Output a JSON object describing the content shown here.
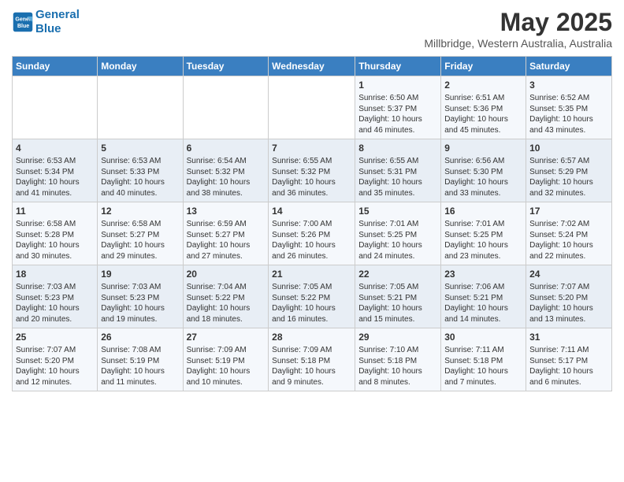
{
  "logo": {
    "line1": "General",
    "line2": "Blue"
  },
  "title": "May 2025",
  "location": "Millbridge, Western Australia, Australia",
  "headers": [
    "Sunday",
    "Monday",
    "Tuesday",
    "Wednesday",
    "Thursday",
    "Friday",
    "Saturday"
  ],
  "weeks": [
    [
      {
        "day": "",
        "info": ""
      },
      {
        "day": "",
        "info": ""
      },
      {
        "day": "",
        "info": ""
      },
      {
        "day": "",
        "info": ""
      },
      {
        "day": "1",
        "info": "Sunrise: 6:50 AM\nSunset: 5:37 PM\nDaylight: 10 hours\nand 46 minutes."
      },
      {
        "day": "2",
        "info": "Sunrise: 6:51 AM\nSunset: 5:36 PM\nDaylight: 10 hours\nand 45 minutes."
      },
      {
        "day": "3",
        "info": "Sunrise: 6:52 AM\nSunset: 5:35 PM\nDaylight: 10 hours\nand 43 minutes."
      }
    ],
    [
      {
        "day": "4",
        "info": "Sunrise: 6:53 AM\nSunset: 5:34 PM\nDaylight: 10 hours\nand 41 minutes."
      },
      {
        "day": "5",
        "info": "Sunrise: 6:53 AM\nSunset: 5:33 PM\nDaylight: 10 hours\nand 40 minutes."
      },
      {
        "day": "6",
        "info": "Sunrise: 6:54 AM\nSunset: 5:32 PM\nDaylight: 10 hours\nand 38 minutes."
      },
      {
        "day": "7",
        "info": "Sunrise: 6:55 AM\nSunset: 5:32 PM\nDaylight: 10 hours\nand 36 minutes."
      },
      {
        "day": "8",
        "info": "Sunrise: 6:55 AM\nSunset: 5:31 PM\nDaylight: 10 hours\nand 35 minutes."
      },
      {
        "day": "9",
        "info": "Sunrise: 6:56 AM\nSunset: 5:30 PM\nDaylight: 10 hours\nand 33 minutes."
      },
      {
        "day": "10",
        "info": "Sunrise: 6:57 AM\nSunset: 5:29 PM\nDaylight: 10 hours\nand 32 minutes."
      }
    ],
    [
      {
        "day": "11",
        "info": "Sunrise: 6:58 AM\nSunset: 5:28 PM\nDaylight: 10 hours\nand 30 minutes."
      },
      {
        "day": "12",
        "info": "Sunrise: 6:58 AM\nSunset: 5:27 PM\nDaylight: 10 hours\nand 29 minutes."
      },
      {
        "day": "13",
        "info": "Sunrise: 6:59 AM\nSunset: 5:27 PM\nDaylight: 10 hours\nand 27 minutes."
      },
      {
        "day": "14",
        "info": "Sunrise: 7:00 AM\nSunset: 5:26 PM\nDaylight: 10 hours\nand 26 minutes."
      },
      {
        "day": "15",
        "info": "Sunrise: 7:01 AM\nSunset: 5:25 PM\nDaylight: 10 hours\nand 24 minutes."
      },
      {
        "day": "16",
        "info": "Sunrise: 7:01 AM\nSunset: 5:25 PM\nDaylight: 10 hours\nand 23 minutes."
      },
      {
        "day": "17",
        "info": "Sunrise: 7:02 AM\nSunset: 5:24 PM\nDaylight: 10 hours\nand 22 minutes."
      }
    ],
    [
      {
        "day": "18",
        "info": "Sunrise: 7:03 AM\nSunset: 5:23 PM\nDaylight: 10 hours\nand 20 minutes."
      },
      {
        "day": "19",
        "info": "Sunrise: 7:03 AM\nSunset: 5:23 PM\nDaylight: 10 hours\nand 19 minutes."
      },
      {
        "day": "20",
        "info": "Sunrise: 7:04 AM\nSunset: 5:22 PM\nDaylight: 10 hours\nand 18 minutes."
      },
      {
        "day": "21",
        "info": "Sunrise: 7:05 AM\nSunset: 5:22 PM\nDaylight: 10 hours\nand 16 minutes."
      },
      {
        "day": "22",
        "info": "Sunrise: 7:05 AM\nSunset: 5:21 PM\nDaylight: 10 hours\nand 15 minutes."
      },
      {
        "day": "23",
        "info": "Sunrise: 7:06 AM\nSunset: 5:21 PM\nDaylight: 10 hours\nand 14 minutes."
      },
      {
        "day": "24",
        "info": "Sunrise: 7:07 AM\nSunset: 5:20 PM\nDaylight: 10 hours\nand 13 minutes."
      }
    ],
    [
      {
        "day": "25",
        "info": "Sunrise: 7:07 AM\nSunset: 5:20 PM\nDaylight: 10 hours\nand 12 minutes."
      },
      {
        "day": "26",
        "info": "Sunrise: 7:08 AM\nSunset: 5:19 PM\nDaylight: 10 hours\nand 11 minutes."
      },
      {
        "day": "27",
        "info": "Sunrise: 7:09 AM\nSunset: 5:19 PM\nDaylight: 10 hours\nand 10 minutes."
      },
      {
        "day": "28",
        "info": "Sunrise: 7:09 AM\nSunset: 5:18 PM\nDaylight: 10 hours\nand 9 minutes."
      },
      {
        "day": "29",
        "info": "Sunrise: 7:10 AM\nSunset: 5:18 PM\nDaylight: 10 hours\nand 8 minutes."
      },
      {
        "day": "30",
        "info": "Sunrise: 7:11 AM\nSunset: 5:18 PM\nDaylight: 10 hours\nand 7 minutes."
      },
      {
        "day": "31",
        "info": "Sunrise: 7:11 AM\nSunset: 5:17 PM\nDaylight: 10 hours\nand 6 minutes."
      }
    ]
  ]
}
